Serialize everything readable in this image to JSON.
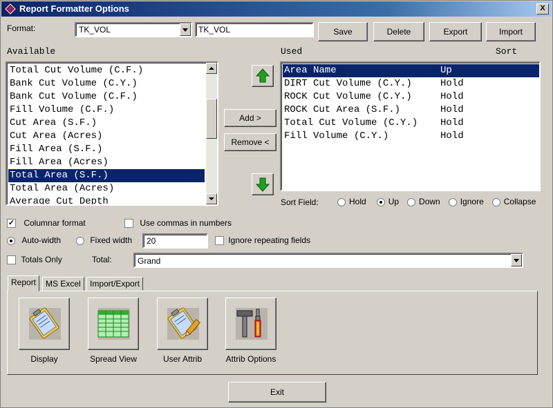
{
  "window": {
    "title": "Report Formatter Options",
    "close_glyph": "X"
  },
  "format": {
    "label": "Format:",
    "combo_value": "TK_VOL",
    "name_value": "TK_VOL",
    "buttons": {
      "save": "Save",
      "delete": "Delete",
      "export": "Export",
      "import": "Import"
    }
  },
  "available": {
    "header": "Available",
    "items": [
      "Total Cut Volume (C.F.)",
      "Bank Cut Volume (C.Y.)",
      "Bank Cut Volume (C.F.)",
      "Fill Volume (C.F.)",
      "Cut Area (S.F.)",
      "Cut Area (Acres)",
      "Fill Area (S.F.)",
      "Fill Area (Acres)",
      "Total Area (S.F.)",
      "Total Area (Acres)",
      "Average Cut Depth"
    ],
    "selected_index": 8
  },
  "middle": {
    "add": "Add >",
    "remove": "Remove <"
  },
  "used": {
    "header": "Used",
    "sort_header": "Sort",
    "rows": [
      {
        "name": "Area Name",
        "sort": "Up"
      },
      {
        "name": "DIRT Cut Volume (C.Y.)",
        "sort": "Hold"
      },
      {
        "name": "ROCK Cut Volume (C.Y.)",
        "sort": "Hold"
      },
      {
        "name": "ROCK Cut Area (S.F.)",
        "sort": "Hold"
      },
      {
        "name": "Total Cut Volume (C.Y.)",
        "sort": "Hold"
      },
      {
        "name": "Fill Volume (C.Y.)",
        "sort": "Hold"
      }
    ],
    "selected_index": 0
  },
  "sort_field": {
    "label": "Sort Field:",
    "options": [
      "Hold",
      "Up",
      "Down",
      "Ignore",
      "Collapse"
    ],
    "selected": "Up"
  },
  "options": {
    "columnar_format": "Columnar format",
    "columnar_checked": true,
    "use_commas": "Use commas in numbers",
    "use_commas_checked": false,
    "auto_width": "Auto-width",
    "fixed_width": "Fixed width",
    "width_mode": "auto",
    "width_value": "20",
    "ignore_repeating": "Ignore repeating fields",
    "ignore_repeating_checked": false,
    "totals_only": "Totals Only",
    "totals_only_checked": false,
    "total_label": "Total:",
    "total_value": "Grand"
  },
  "tabs": [
    "Report",
    "MS Excel",
    "Import/Export"
  ],
  "active_tab": "Report",
  "report_buttons": [
    {
      "label": "Display",
      "icon": "clipboard-icon"
    },
    {
      "label": "Spread View",
      "icon": "spreadsheet-icon"
    },
    {
      "label": "User Attrib",
      "icon": "clipboard-pencil-icon"
    },
    {
      "label": "Attrib Options",
      "icon": "tools-icon"
    }
  ],
  "exit": "Exit",
  "colors": {
    "selection": "#0a246a",
    "title_bar": "#0a246a",
    "arrow_green": "#22a022"
  }
}
